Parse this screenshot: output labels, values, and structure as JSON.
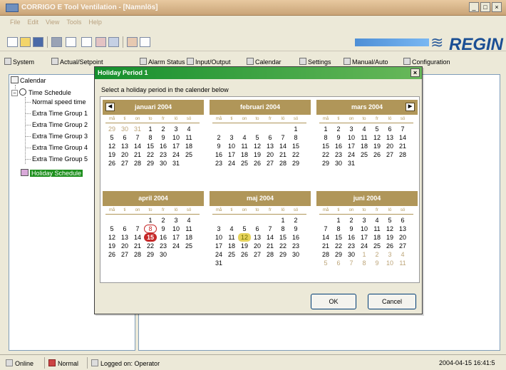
{
  "window": {
    "title": "CORRIGO E Tool Ventilation - [Namnlös]",
    "controls": [
      "_",
      "□",
      "×"
    ]
  },
  "menu": [
    "File",
    "Edit",
    "View",
    "Tools",
    "Help"
  ],
  "brand": {
    "logo": "REGIN",
    "wave": "≋"
  },
  "tabs": [
    "System",
    "Actual/Setpoint",
    "Alarm Status",
    "Input/Output",
    "Calendar",
    "Settings",
    "Manual/Auto",
    "Configuration"
  ],
  "tree": {
    "root": "Calendar",
    "time_schedule": "Time Schedule",
    "items": [
      "Normal speed time",
      "Extra Time Group 1",
      "Extra Time Group 2",
      "Extra Time Group 3",
      "Extra Time Group 4",
      "Extra Time Group 5"
    ],
    "holiday": "Holiday Schedule"
  },
  "status": {
    "online": "Online",
    "normal": "Normal",
    "logged": "Logged on: Operator",
    "datetime": "2004-04-15  16:41:5"
  },
  "dialog": {
    "title": "Holiday Period 1",
    "instruction": "Select a holiday period in the calender below",
    "close": "×",
    "ok": "OK",
    "cancel": "Cancel",
    "nav_prev": "◀",
    "nav_next": "▶",
    "weekdays": [
      "må",
      "ti",
      "on",
      "to",
      "fr",
      "lö",
      "sö"
    ],
    "months": [
      {
        "name": "januari 2004",
        "days": [
          {
            "t": "29",
            "o": true
          },
          {
            "t": "30",
            "o": true
          },
          {
            "t": "31",
            "o": true
          },
          {
            "t": "1"
          },
          {
            "t": "2"
          },
          {
            "t": "3"
          },
          {
            "t": "4"
          },
          {
            "t": "5"
          },
          {
            "t": "6"
          },
          {
            "t": "7"
          },
          {
            "t": "8"
          },
          {
            "t": "9"
          },
          {
            "t": "10"
          },
          {
            "t": "11"
          },
          {
            "t": "12"
          },
          {
            "t": "13"
          },
          {
            "t": "14"
          },
          {
            "t": "15"
          },
          {
            "t": "16"
          },
          {
            "t": "17"
          },
          {
            "t": "18"
          },
          {
            "t": "19"
          },
          {
            "t": "20"
          },
          {
            "t": "21"
          },
          {
            "t": "22"
          },
          {
            "t": "23"
          },
          {
            "t": "24"
          },
          {
            "t": "25"
          },
          {
            "t": "26"
          },
          {
            "t": "27"
          },
          {
            "t": "28"
          },
          {
            "t": "29"
          },
          {
            "t": "30"
          },
          {
            "t": "31"
          }
        ]
      },
      {
        "name": "februari 2004",
        "days": [
          {
            "t": ""
          },
          {
            "t": ""
          },
          {
            "t": ""
          },
          {
            "t": ""
          },
          {
            "t": ""
          },
          {
            "t": ""
          },
          {
            "t": "1"
          },
          {
            "t": "2"
          },
          {
            "t": "3"
          },
          {
            "t": "4"
          },
          {
            "t": "5"
          },
          {
            "t": "6"
          },
          {
            "t": "7"
          },
          {
            "t": "8"
          },
          {
            "t": "9"
          },
          {
            "t": "10"
          },
          {
            "t": "11"
          },
          {
            "t": "12"
          },
          {
            "t": "13"
          },
          {
            "t": "14"
          },
          {
            "t": "15"
          },
          {
            "t": "16"
          },
          {
            "t": "17"
          },
          {
            "t": "18"
          },
          {
            "t": "19"
          },
          {
            "t": "20"
          },
          {
            "t": "21"
          },
          {
            "t": "22"
          },
          {
            "t": "23"
          },
          {
            "t": "24"
          },
          {
            "t": "25"
          },
          {
            "t": "26"
          },
          {
            "t": "27"
          },
          {
            "t": "28"
          },
          {
            "t": "29"
          }
        ]
      },
      {
        "name": "mars 2004",
        "days": [
          {
            "t": "1"
          },
          {
            "t": "2"
          },
          {
            "t": "3"
          },
          {
            "t": "4"
          },
          {
            "t": "5"
          },
          {
            "t": "6"
          },
          {
            "t": "7"
          },
          {
            "t": "8"
          },
          {
            "t": "9"
          },
          {
            "t": "10"
          },
          {
            "t": "11"
          },
          {
            "t": "12"
          },
          {
            "t": "13"
          },
          {
            "t": "14"
          },
          {
            "t": "15"
          },
          {
            "t": "16"
          },
          {
            "t": "17"
          },
          {
            "t": "18"
          },
          {
            "t": "19"
          },
          {
            "t": "20"
          },
          {
            "t": "21"
          },
          {
            "t": "22"
          },
          {
            "t": "23"
          },
          {
            "t": "24"
          },
          {
            "t": "25"
          },
          {
            "t": "26"
          },
          {
            "t": "27"
          },
          {
            "t": "28"
          },
          {
            "t": "29"
          },
          {
            "t": "30"
          },
          {
            "t": "31"
          }
        ]
      },
      {
        "name": "april 2004",
        "days": [
          {
            "t": ""
          },
          {
            "t": ""
          },
          {
            "t": ""
          },
          {
            "t": "1"
          },
          {
            "t": "2"
          },
          {
            "t": "3"
          },
          {
            "t": "4"
          },
          {
            "t": "5"
          },
          {
            "t": "6"
          },
          {
            "t": "7"
          },
          {
            "t": "8",
            "ring": true
          },
          {
            "t": "9"
          },
          {
            "t": "10"
          },
          {
            "t": "11"
          },
          {
            "t": "12"
          },
          {
            "t": "13"
          },
          {
            "t": "14"
          },
          {
            "t": "15",
            "sel": true
          },
          {
            "t": "16"
          },
          {
            "t": "17"
          },
          {
            "t": "18"
          },
          {
            "t": "19"
          },
          {
            "t": "20"
          },
          {
            "t": "21"
          },
          {
            "t": "22"
          },
          {
            "t": "23"
          },
          {
            "t": "24"
          },
          {
            "t": "25"
          },
          {
            "t": "26"
          },
          {
            "t": "27"
          },
          {
            "t": "28"
          },
          {
            "t": "29"
          },
          {
            "t": "30"
          }
        ]
      },
      {
        "name": "maj 2004",
        "days": [
          {
            "t": ""
          },
          {
            "t": ""
          },
          {
            "t": ""
          },
          {
            "t": ""
          },
          {
            "t": ""
          },
          {
            "t": "1"
          },
          {
            "t": "2"
          },
          {
            "t": "3"
          },
          {
            "t": "4"
          },
          {
            "t": "5"
          },
          {
            "t": "6"
          },
          {
            "t": "7"
          },
          {
            "t": "8"
          },
          {
            "t": "9"
          },
          {
            "t": "10"
          },
          {
            "t": "11"
          },
          {
            "t": "12",
            "mark": true
          },
          {
            "t": "13"
          },
          {
            "t": "14"
          },
          {
            "t": "15"
          },
          {
            "t": "16"
          },
          {
            "t": "17"
          },
          {
            "t": "18"
          },
          {
            "t": "19"
          },
          {
            "t": "20"
          },
          {
            "t": "21"
          },
          {
            "t": "22"
          },
          {
            "t": "23"
          },
          {
            "t": "24"
          },
          {
            "t": "25"
          },
          {
            "t": "26"
          },
          {
            "t": "27"
          },
          {
            "t": "28"
          },
          {
            "t": "29"
          },
          {
            "t": "30"
          },
          {
            "t": "31"
          }
        ]
      },
      {
        "name": "juni 2004",
        "days": [
          {
            "t": ""
          },
          {
            "t": "1"
          },
          {
            "t": "2"
          },
          {
            "t": "3"
          },
          {
            "t": "4"
          },
          {
            "t": "5"
          },
          {
            "t": "6"
          },
          {
            "t": "7"
          },
          {
            "t": "8"
          },
          {
            "t": "9"
          },
          {
            "t": "10"
          },
          {
            "t": "11"
          },
          {
            "t": "12"
          },
          {
            "t": "13"
          },
          {
            "t": "14"
          },
          {
            "t": "15"
          },
          {
            "t": "16"
          },
          {
            "t": "17"
          },
          {
            "t": "18"
          },
          {
            "t": "19"
          },
          {
            "t": "20"
          },
          {
            "t": "21"
          },
          {
            "t": "22"
          },
          {
            "t": "23"
          },
          {
            "t": "24"
          },
          {
            "t": "25"
          },
          {
            "t": "26"
          },
          {
            "t": "27"
          },
          {
            "t": "28"
          },
          {
            "t": "29"
          },
          {
            "t": "30"
          },
          {
            "t": "1",
            "o": true
          },
          {
            "t": "2",
            "o": true
          },
          {
            "t": "3",
            "o": true
          },
          {
            "t": "4",
            "o": true
          },
          {
            "t": "5",
            "o": true
          },
          {
            "t": "6",
            "o": true
          },
          {
            "t": "7",
            "o": true
          },
          {
            "t": "8",
            "o": true
          },
          {
            "t": "9",
            "o": true
          },
          {
            "t": "10",
            "o": true
          },
          {
            "t": "11",
            "o": true
          }
        ]
      }
    ]
  },
  "colors": {
    "title_green": "#158f2d",
    "month_header": "#b09659",
    "selected_day": "#c62828",
    "tree_selected": "#1d8f1d",
    "brand_blue": "#1b4f94"
  }
}
